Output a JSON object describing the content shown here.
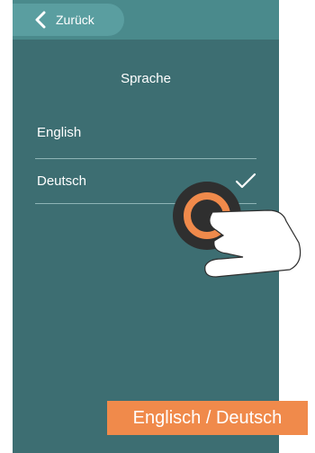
{
  "topbar": {
    "back_label": "Zurück"
  },
  "screen": {
    "title": "Sprache"
  },
  "languages": [
    {
      "label": "English",
      "selected": false
    },
    {
      "label": "Deutsch",
      "selected": true
    }
  ],
  "caption": {
    "text": "Englisch / Deutsch"
  },
  "colors": {
    "background": "#3d6e72",
    "topbar": "#4a8a8c",
    "back_button": "#5a9ea0",
    "accent": "#f08a4b"
  },
  "icons": [
    "chevron-left-icon",
    "checkmark-icon",
    "tap-gesture-icon"
  ]
}
